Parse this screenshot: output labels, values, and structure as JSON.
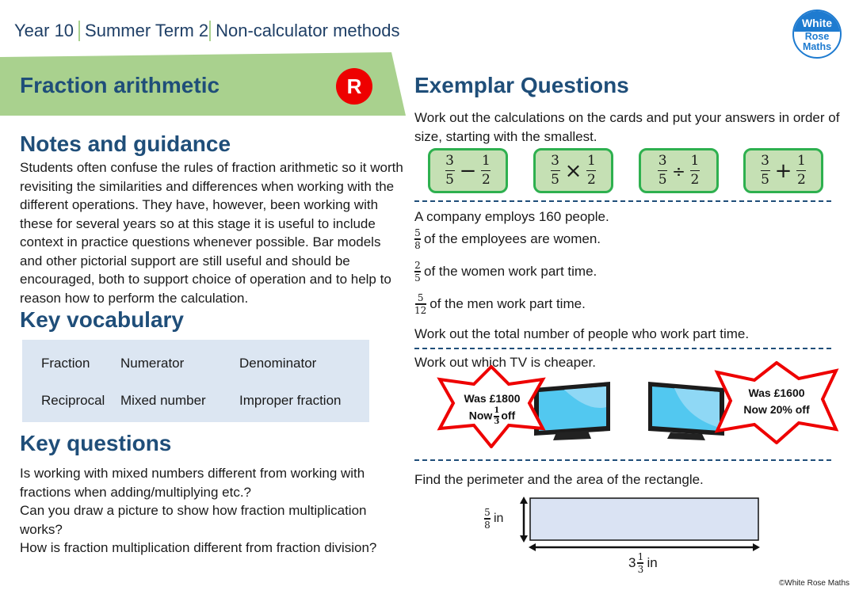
{
  "header": {
    "breadcrumb": [
      "Year 10",
      "Summer Term 2",
      "Non-calculator methods"
    ],
    "logo": {
      "line1": "White",
      "line2": "Rose",
      "line3": "Maths"
    }
  },
  "banner": {
    "title": "Fraction arithmetic",
    "badge": "R",
    "color": "#a9d18e"
  },
  "notes": {
    "heading": "Notes and guidance",
    "body": "Students often confuse the rules of fraction arithmetic so it worth revisiting the similarities and differences when working with the different operations. They have, however, been working with these for several years so at this stage it is useful to include context in practice questions whenever possible. Bar models and other pictorial support are still useful and should be encouraged, both to support choice of operation and to help to reason how to perform the calculation."
  },
  "vocabulary": {
    "heading": "Key vocabulary",
    "words": [
      "Fraction",
      "Numerator",
      "Denominator",
      "Reciprocal",
      "Mixed number",
      "Improper fraction"
    ]
  },
  "key_questions": {
    "heading": "Key questions",
    "items": [
      "Is working with mixed numbers different from working with fractions when adding/multiplying etc.?",
      "Can you draw a picture to show how fraction multiplication works?",
      "How is fraction multiplication different from fraction division?"
    ]
  },
  "exemplar": {
    "heading": "Exemplar Questions",
    "q1": {
      "text": "Work out the calculations on the cards and put your answers in order of size, starting with the smallest.",
      "cards": [
        {
          "a_num": "3",
          "a_den": "5",
          "op": "−",
          "b_num": "1",
          "b_den": "2"
        },
        {
          "a_num": "3",
          "a_den": "5",
          "op": "×",
          "b_num": "1",
          "b_den": "2"
        },
        {
          "a_num": "3",
          "a_den": "5",
          "op": "÷",
          "b_num": "1",
          "b_den": "2"
        },
        {
          "a_num": "3",
          "a_den": "5",
          "op": "+",
          "b_num": "1",
          "b_den": "2"
        }
      ]
    },
    "q2": {
      "intro": "A company employs 160 people.",
      "lines": [
        {
          "num": "5",
          "den": "8",
          "text": "of the employees are women."
        },
        {
          "num": "2",
          "den": "5",
          "text": "of the women work part time."
        },
        {
          "num": "5",
          "den": "12",
          "text": "of the men work part time."
        }
      ],
      "task": "Work out the total number of people who work part time."
    },
    "q3": {
      "text": "Work out which TV is cheaper.",
      "tv1": {
        "was": "Was £1800",
        "now_prefix": "Now",
        "num": "1",
        "den": "3",
        "now_suffix": "off"
      },
      "tv2": {
        "was": "Was £1600",
        "now": "Now 20% off"
      }
    },
    "q4": {
      "text": "Find the perimeter and the area of the rectangle.",
      "height": {
        "num": "5",
        "den": "8",
        "unit": "in"
      },
      "width": {
        "whole": "3",
        "num": "1",
        "den": "3",
        "unit": "in"
      }
    }
  },
  "footer": {
    "copyright": "©White Rose Maths"
  }
}
